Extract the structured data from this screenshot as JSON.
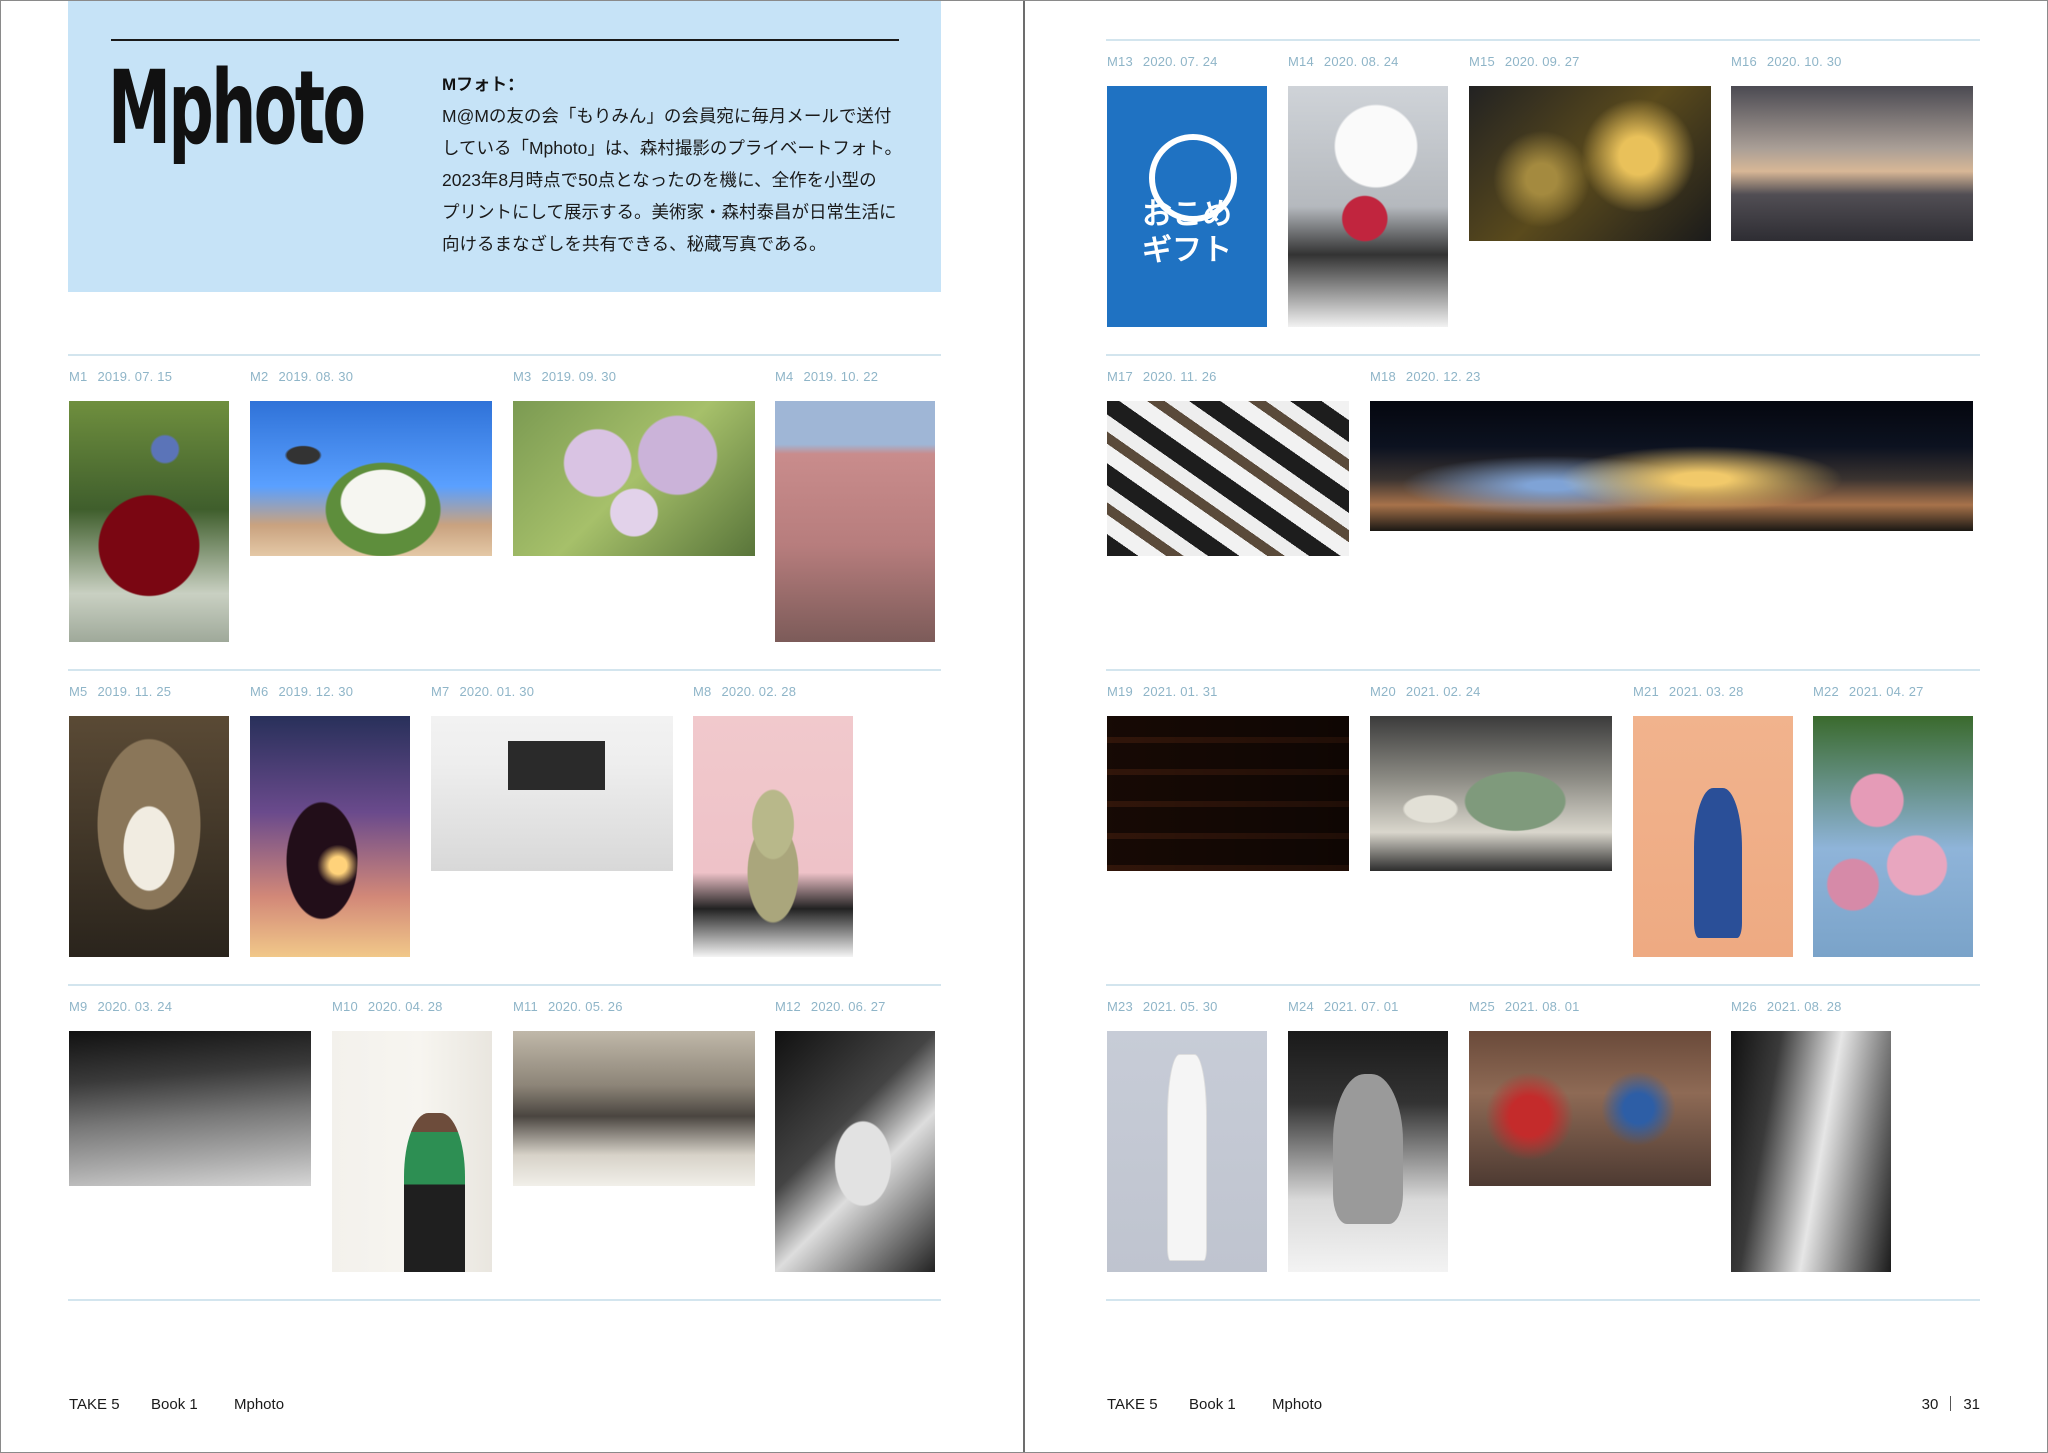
{
  "intro": {
    "title": "Mphoto",
    "subtitle": "Mフォト：",
    "body": "M@Mの友の会「もりみん」の会員宛に毎月メールで送付\nしている「Mphoto」は、森村撮影のプライベートフォト。\n2023年8月時点で50点となったのを機に、全作を小型の\nプリントにして展示する。美術家・森村泰昌が日常生活に\n向けるまなざしを共有できる、秘蔵写真である。"
  },
  "photos": [
    {
      "id": "M1",
      "date": "2019. 07. 15"
    },
    {
      "id": "M2",
      "date": "2019. 08. 30"
    },
    {
      "id": "M3",
      "date": "2019. 09. 30"
    },
    {
      "id": "M4",
      "date": "2019. 10. 22"
    },
    {
      "id": "M5",
      "date": "2019. 11. 25"
    },
    {
      "id": "M6",
      "date": "2019. 12. 30"
    },
    {
      "id": "M7",
      "date": "2020. 01. 30"
    },
    {
      "id": "M8",
      "date": "2020. 02. 28"
    },
    {
      "id": "M9",
      "date": "2020. 03. 24"
    },
    {
      "id": "M10",
      "date": "2020. 04. 28"
    },
    {
      "id": "M11",
      "date": "2020. 05. 26"
    },
    {
      "id": "M12",
      "date": "2020. 06. 27"
    },
    {
      "id": "M13",
      "date": "2020. 07. 24",
      "print": "おこめ\nギフト"
    },
    {
      "id": "M14",
      "date": "2020. 08. 24"
    },
    {
      "id": "M15",
      "date": "2020. 09. 27"
    },
    {
      "id": "M16",
      "date": "2020. 10. 30"
    },
    {
      "id": "M17",
      "date": "2020. 11. 26"
    },
    {
      "id": "M18",
      "date": "2020. 12. 23"
    },
    {
      "id": "M19",
      "date": "2021. 01. 31"
    },
    {
      "id": "M20",
      "date": "2021. 02. 24"
    },
    {
      "id": "M21",
      "date": "2021. 03. 28"
    },
    {
      "id": "M22",
      "date": "2021. 04. 27"
    },
    {
      "id": "M23",
      "date": "2021. 05. 30"
    },
    {
      "id": "M24",
      "date": "2021. 07. 01"
    },
    {
      "id": "M25",
      "date": "2021. 08. 01"
    },
    {
      "id": "M26",
      "date": "2021. 08. 28"
    }
  ],
  "footer": {
    "left": [
      "TAKE 5",
      "Book 1",
      "Mphoto"
    ],
    "right": [
      "TAKE 5",
      "Book 1",
      "Mphoto"
    ],
    "page_left": "30",
    "page_right": "31"
  }
}
